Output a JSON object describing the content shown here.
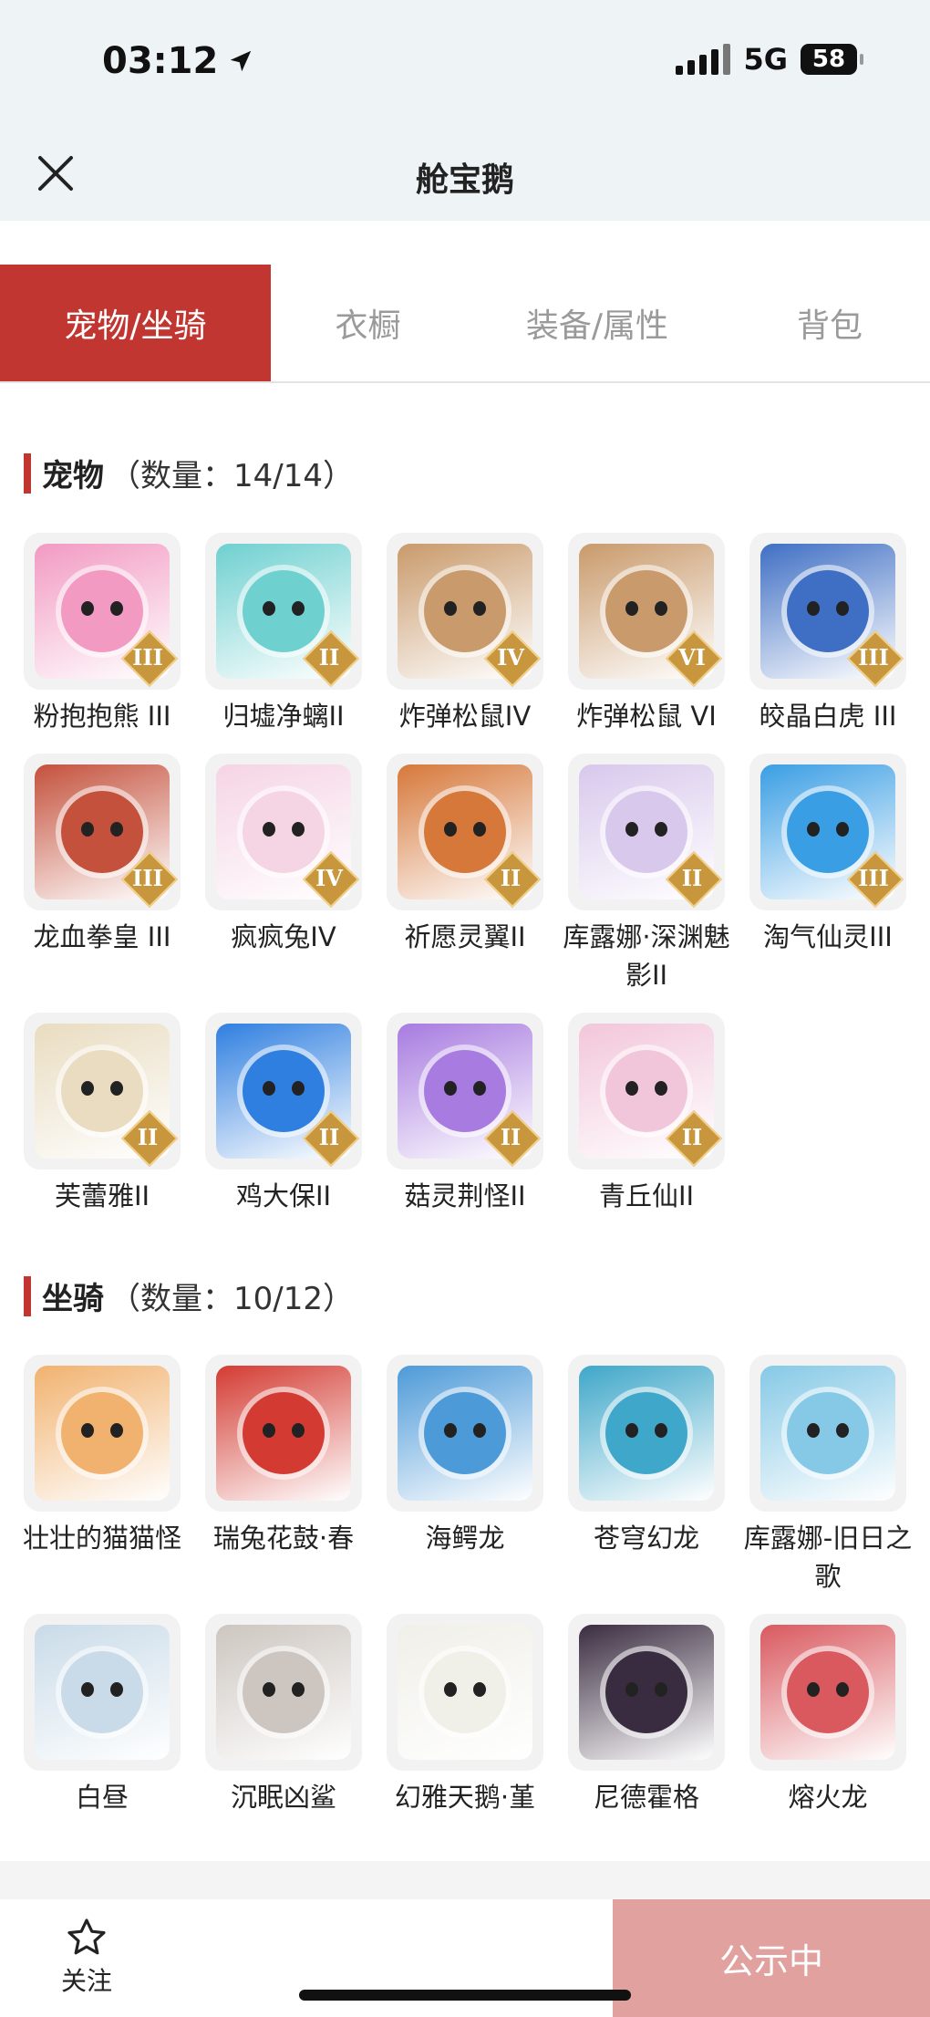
{
  "status": {
    "time": "03:12",
    "network": "5G",
    "battery": "58"
  },
  "header": {
    "title": "舱宝鹅"
  },
  "tabs": [
    {
      "label": "宠物/坐骑",
      "active": true
    },
    {
      "label": "衣橱",
      "active": false
    },
    {
      "label": "装备/属性",
      "active": false
    },
    {
      "label": "背包",
      "active": false
    }
  ],
  "pets": {
    "title": "宠物",
    "count": "（数量：14/14）",
    "items": [
      {
        "name": "粉抱抱熊 III",
        "rank": "III",
        "color": "#f29ac2"
      },
      {
        "name": "归墟净螭II",
        "rank": "II",
        "color": "#6fd0d0"
      },
      {
        "name": "炸弹松鼠IV",
        "rank": "IV",
        "color": "#c99a6b"
      },
      {
        "name": "炸弹松鼠 VI",
        "rank": "VI",
        "color": "#c99a6b"
      },
      {
        "name": "皎晶白虎 III",
        "rank": "III",
        "color": "#3f6fc4"
      },
      {
        "name": "龙血拳皇 III",
        "rank": "III",
        "color": "#c4513c"
      },
      {
        "name": "疯疯兔IV",
        "rank": "IV",
        "color": "#f5d4e4"
      },
      {
        "name": "祈愿灵翼II",
        "rank": "II",
        "color": "#d6783a"
      },
      {
        "name": "库露娜·深渊魅影II",
        "rank": "II",
        "color": "#d8c8ec"
      },
      {
        "name": "淘气仙灵III",
        "rank": "III",
        "color": "#3a9ee4"
      },
      {
        "name": "芙蕾雅II",
        "rank": "II",
        "color": "#e9dcc0"
      },
      {
        "name": "鸡大保II",
        "rank": "II",
        "color": "#2f7fe0"
      },
      {
        "name": "菇灵荆怪II",
        "rank": "II",
        "color": "#a77be0"
      },
      {
        "name": "青丘仙II",
        "rank": "II",
        "color": "#f2c6da"
      }
    ]
  },
  "mounts": {
    "title": "坐骑",
    "count": "（数量：10/12）",
    "items": [
      {
        "name": "壮壮的猫猫怪",
        "color": "#f1b26f"
      },
      {
        "name": "瑞兔花鼓·春",
        "color": "#d33b32"
      },
      {
        "name": "海鳄龙",
        "color": "#4d9ad8"
      },
      {
        "name": "苍穹幻龙",
        "color": "#3fa7c9"
      },
      {
        "name": "库露娜-旧日之歌",
        "color": "#86c9e6"
      },
      {
        "name": "白昼",
        "color": "#c9dbe8"
      },
      {
        "name": "沉眠凶鲨",
        "color": "#cdc6c0"
      },
      {
        "name": "幻雅天鹅·堇",
        "color": "#f0efe8"
      },
      {
        "name": "尼德霍格",
        "color": "#3a2c40"
      },
      {
        "name": "熔火龙",
        "color": "#d9595f"
      }
    ]
  },
  "bottom": {
    "follow_label": "关注",
    "public_label": "公示中"
  }
}
